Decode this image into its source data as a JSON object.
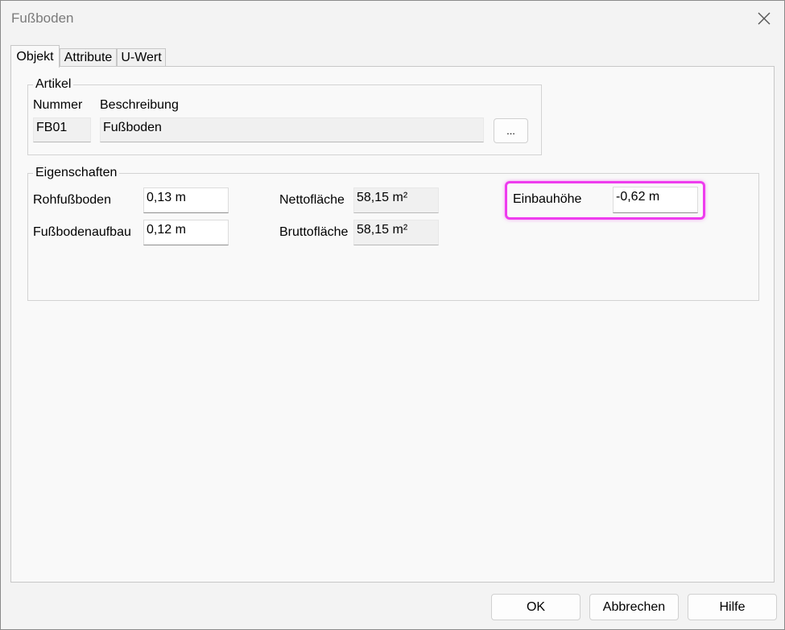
{
  "window": {
    "title": "Fußboden",
    "close_icon": "close-icon"
  },
  "tabs": [
    {
      "label": "Objekt",
      "active": true
    },
    {
      "label": "Attribute",
      "active": false
    },
    {
      "label": "U-Wert",
      "active": false
    }
  ],
  "artikel": {
    "legend": "Artikel",
    "nummer_label": "Nummer",
    "beschreibung_label": "Beschreibung",
    "nummer_value": "FB01",
    "beschreibung_value": "Fußboden",
    "browse_button_label": "..."
  },
  "eigenschaften": {
    "legend": "Eigenschaften",
    "rohfussboden_label": "Rohfußboden",
    "rohfussboden_value": "0,13 m",
    "fussbodenaufbau_label": "Fußbodenaufbau",
    "fussbodenaufbau_value": "0,12 m",
    "nettoflaeche_label": "Nettofläche",
    "nettoflaeche_value": "58,15 m²",
    "bruttoflaeche_label": "Bruttofläche",
    "bruttoflaeche_value": "58,15 m²",
    "einbauhoehe_label": "Einbauhöhe",
    "einbauhoehe_value": "-0,62 m"
  },
  "buttons": {
    "ok": "OK",
    "cancel": "Abbrechen",
    "help": "Hilfe"
  },
  "colors": {
    "highlight": "#ee3cee"
  }
}
